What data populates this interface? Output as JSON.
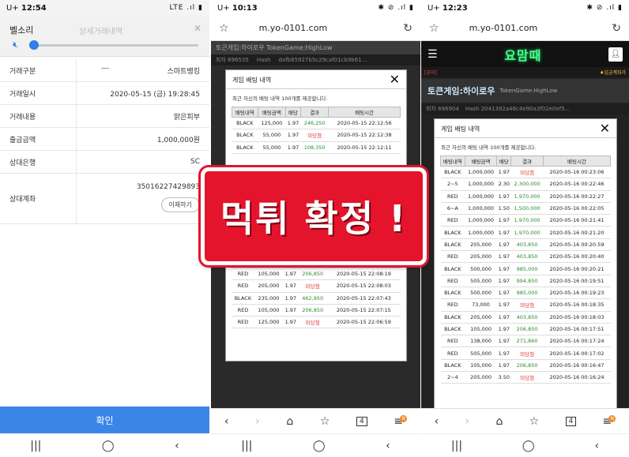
{
  "phone1": {
    "status": {
      "time": "12:54",
      "carrier": "U+",
      "icons": "LTE .ıl ▮"
    },
    "volume_label": "벨소리",
    "title_faded": "상세거래내역",
    "rows": [
      {
        "label": "거래구분",
        "value": "스마트뱅킹"
      },
      {
        "label": "거래일시",
        "value": "2020-05-15 (금) 19:28:45"
      },
      {
        "label": "거래내용",
        "value": "맑은피부"
      },
      {
        "label": "출금금액",
        "value": "1,000,000원"
      },
      {
        "label": "상대은행",
        "value": "SC"
      },
      {
        "label": "상대계좌",
        "value": "35016227429893"
      }
    ],
    "copy_button": "이체하기",
    "confirm_button": "확인"
  },
  "phone2": {
    "status": {
      "time": "10:13",
      "carrier": "U+",
      "icons": "✱ ⊘ .ıl ▮"
    },
    "url": "m.yo-0101.com",
    "game_header": "토큰게임:하이로우 TokenGame:HighLow",
    "game_sub": {
      "round": "회차 696535",
      "hash_label": "Hash",
      "hash_value": "dafb65927b5c29caf01cb9b61..."
    },
    "modal_title": "게임 배팅 내역",
    "modal_note": "최근 자신의 배팅 내역 100개를 제공합니다.",
    "columns": [
      "배팅내역",
      "배팅금액",
      "배당",
      "결과",
      "배팅시간"
    ],
    "rows_top": [
      [
        "BLACK",
        "125,000",
        "1.97",
        "246,250",
        "2020-05-15 22:12:56"
      ],
      [
        "BLACK",
        "55,000",
        "1.97",
        "미당첨",
        "2020-05-15 22:12:38"
      ],
      [
        "BLACK",
        "55,000",
        "1.97",
        "108,350",
        "2020-05-15 22:12:11"
      ]
    ],
    "rows_bottom": [
      [
        "RED",
        "505,000",
        "1.97",
        "994,850",
        "2020-05-15 22:09:02"
      ],
      [
        "RED",
        "55,000",
        "1.97",
        "108,350",
        "2020-05-15 22:08:44"
      ],
      [
        "RED",
        "105,000",
        "1.97",
        "206,850",
        "2020-05-15 22:08:19"
      ],
      [
        "RED",
        "205,000",
        "1.97",
        "미당첨",
        "2020-05-15 22:08:03"
      ],
      [
        "BLACK",
        "235,000",
        "1.97",
        "462,950",
        "2020-05-15 22:07:43"
      ],
      [
        "RED",
        "105,000",
        "1.97",
        "206,850",
        "2020-05-15 22:07:15"
      ],
      [
        "RED",
        "125,000",
        "1.97",
        "미당첨",
        "2020-05-15 22:06:59"
      ]
    ],
    "tab_count": "4",
    "menu_badge": "N"
  },
  "phone3": {
    "status": {
      "time": "12:23",
      "carrier": "U+",
      "icons": "✱ ⊘ .ıl ▮"
    },
    "url": "m.yo-0101.com",
    "logo": "요맘때",
    "notice_left": "[공지]",
    "notice_right": "♦입금계좌가",
    "game_title": "토큰게임:하이로우",
    "game_subtitle": "TokenGame:HighLow",
    "hash_row": {
      "round": "회차 696904",
      "hash": "Hash 2041382a48c4e90a3f02e0ef5..."
    },
    "modal_title": "게임 배팅 내역",
    "modal_note": "최근 자신의 배팅 내역 100개를 제공합니다.",
    "columns": [
      "배팅내역",
      "배팅금액",
      "배당",
      "결과",
      "배팅시간"
    ],
    "rows": [
      [
        "BLACK",
        "1,000,000",
        "1.97",
        "미당첨",
        "2020-05-16 00:23:06"
      ],
      [
        "2~5",
        "1,000,000",
        "2.30",
        "2,300,000",
        "2020-05-16 00:22:46"
      ],
      [
        "RED",
        "1,000,000",
        "1.97",
        "1,970,000",
        "2020-05-16 00:22:27"
      ],
      [
        "6~A",
        "1,000,000",
        "1.50",
        "1,500,000",
        "2020-05-16 00:22:05"
      ],
      [
        "RED",
        "1,000,000",
        "1.97",
        "1,970,000",
        "2020-05-16 00:21:41"
      ],
      [
        "BLACK",
        "1,000,000",
        "1.97",
        "1,970,000",
        "2020-05-16 00:21:20"
      ],
      [
        "BLACK",
        "205,000",
        "1.97",
        "403,850",
        "2020-05-16 00:20:59"
      ],
      [
        "RED",
        "205,000",
        "1.97",
        "403,850",
        "2020-05-16 00:20:40"
      ],
      [
        "BLACK",
        "500,000",
        "1.97",
        "985,000",
        "2020-05-16 00:20:21"
      ],
      [
        "RED",
        "505,000",
        "1.97",
        "994,850",
        "2020-05-16 00:19:51"
      ],
      [
        "BLACK",
        "500,000",
        "1.97",
        "985,000",
        "2020-05-16 00:19:23"
      ],
      [
        "RED",
        "73,000",
        "1.97",
        "미당첨",
        "2020-05-16 00:18:35"
      ],
      [
        "BLACK",
        "205,000",
        "1.97",
        "403,850",
        "2020-05-16 00:18:03"
      ],
      [
        "BLACK",
        "105,000",
        "1.97",
        "206,850",
        "2020-05-16 00:17:51"
      ],
      [
        "RED",
        "138,000",
        "1.97",
        "271,860",
        "2020-05-16 00:17:24"
      ],
      [
        "RED",
        "505,000",
        "1.97",
        "미당첨",
        "2020-05-16 00:17:02"
      ],
      [
        "BLACK",
        "105,000",
        "1.97",
        "206,850",
        "2020-05-16 00:16:47"
      ],
      [
        "2~4",
        "205,000",
        "3.50",
        "미당첨",
        "2020-05-16 00:16:24"
      ]
    ],
    "tab_count": "4",
    "menu_badge": "N"
  },
  "stamp_text": "먹튀 확정 !",
  "colors": {
    "stamp_red": "#e4142c",
    "confirm_blue": "#3a86e8",
    "win_green": "#2a8a2a",
    "lose_red": "#d33333",
    "logo_green": "#44ff88"
  }
}
